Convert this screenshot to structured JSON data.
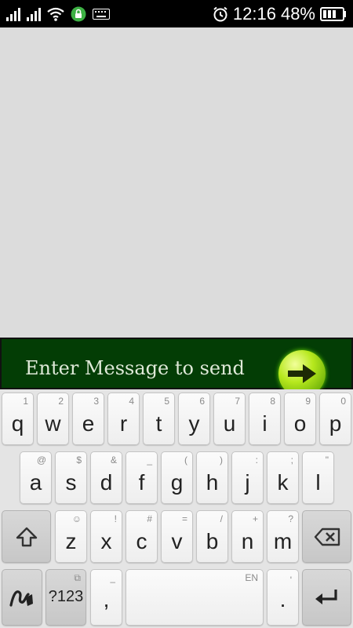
{
  "status_bar": {
    "time": "12:16",
    "battery": "48%"
  },
  "message": {
    "placeholder": "Enter Message to send"
  },
  "keyboard": {
    "row1": [
      {
        "k": "q",
        "h": "1"
      },
      {
        "k": "w",
        "h": "2"
      },
      {
        "k": "e",
        "h": "3"
      },
      {
        "k": "r",
        "h": "4"
      },
      {
        "k": "t",
        "h": "5"
      },
      {
        "k": "y",
        "h": "6"
      },
      {
        "k": "u",
        "h": "7"
      },
      {
        "k": "i",
        "h": "8"
      },
      {
        "k": "o",
        "h": "9"
      },
      {
        "k": "p",
        "h": "0"
      }
    ],
    "row2": [
      {
        "k": "a",
        "h": "@"
      },
      {
        "k": "s",
        "h": "$"
      },
      {
        "k": "d",
        "h": "&"
      },
      {
        "k": "f",
        "h": "_"
      },
      {
        "k": "g",
        "h": "("
      },
      {
        "k": "h",
        "h": ")"
      },
      {
        "k": "j",
        "h": ":"
      },
      {
        "k": "k",
        "h": ";"
      },
      {
        "k": "l",
        "h": "\""
      }
    ],
    "row3": [
      {
        "k": "z",
        "h": "☺"
      },
      {
        "k": "x",
        "h": "!"
      },
      {
        "k": "c",
        "h": "#"
      },
      {
        "k": "v",
        "h": "="
      },
      {
        "k": "b",
        "h": "/"
      },
      {
        "k": "n",
        "h": "+"
      },
      {
        "k": "m",
        "h": "?"
      }
    ],
    "symbols_label": "?123",
    "comma": ",",
    "comma_hint": "–",
    "space_hint": "EN",
    "period": ".",
    "period_hint": "'"
  }
}
